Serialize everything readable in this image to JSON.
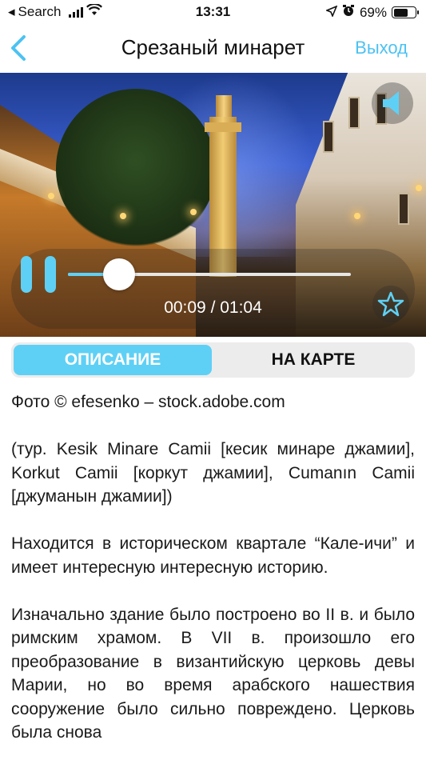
{
  "status_bar": {
    "back_app": "Search",
    "time": "13:31",
    "battery_percent": "69%",
    "battery_level": 0.69,
    "icons": [
      "back-arrow-icon",
      "signal-icon",
      "wifi-icon",
      "location-icon",
      "alarm-icon",
      "battery-icon"
    ]
  },
  "nav": {
    "title": "Срезаный минарет",
    "exit_label": "Выход",
    "back_icon": "chevron-left-icon",
    "accent_color": "#4cc2f2"
  },
  "player": {
    "current_time": "00:09 / 01:04",
    "progress": 0.18,
    "icons": [
      "pause-icon",
      "star-icon",
      "sound-icon"
    ],
    "accent_color": "#5fd0f5"
  },
  "tabs": {
    "items": [
      {
        "label": "ОПИСАНИЕ",
        "active": true
      },
      {
        "label": "НА КАРТЕ",
        "active": false
      }
    ]
  },
  "content": {
    "paragraphs": [
      "Фото © efesenko – stock.adobe.com",
      "(тур. Kesik Minare Camii [кесик минаре джамии], Korkut Camii [коркут джамии], Cumanın Camii [джуманын джамии])",
      "Находится в историческом квартале “Кале-ичи” и имеет интересную интересную историю.",
      "Изначально здание было построено во II в. и было римским храмом. В VII в. произошло его преобразование в византийскую церковь девы Марии, но во время арабского нашествия сооружение было сильно повреждено. Церковь была снова"
    ]
  }
}
